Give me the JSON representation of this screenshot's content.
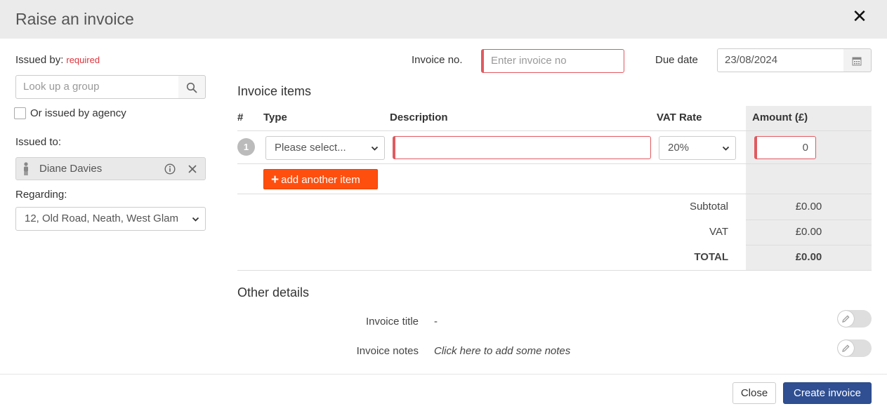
{
  "dialog": {
    "title": "Raise an invoice"
  },
  "left": {
    "issued_by_label": "Issued by:",
    "required_text": "required",
    "group_search_placeholder": "Look up a group",
    "agency_checkbox_label": "Or issued by agency",
    "agency_checked": false,
    "issued_to_label": "Issued to:",
    "issued_to_name": "Diane Davies",
    "regarding_label": "Regarding:",
    "regarding_value": "12, Old Road, Neath, West Glam"
  },
  "top_fields": {
    "invoice_no_label": "Invoice no.",
    "invoice_no_placeholder": "Enter invoice no",
    "due_date_label": "Due date",
    "due_date_value": "23/08/2024"
  },
  "items": {
    "section_title": "Invoice items",
    "columns": [
      "#",
      "Type",
      "Description",
      "VAT Rate",
      "Amount (£)"
    ],
    "rows": [
      {
        "number": "1",
        "type": "Please select...",
        "description": "",
        "vat_rate": "20%",
        "amount": "0"
      }
    ],
    "add_button_label": "add another item"
  },
  "totals": {
    "subtotal_label": "Subtotal",
    "subtotal_value": "£0.00",
    "vat_label": "VAT",
    "vat_value": "£0.00",
    "total_label": "TOTAL",
    "total_value": "£0.00"
  },
  "other_details": {
    "section_title": "Other details",
    "title_label": "Invoice title",
    "title_value": "-",
    "notes_label": "Invoice notes",
    "notes_value": "Click here to add some notes"
  },
  "footer": {
    "close_label": "Close",
    "create_label": "Create invoice"
  },
  "colors": {
    "accent_orange": "#ff4f0f",
    "primary_blue": "#2f4f92",
    "error_red": "#e05a60"
  }
}
